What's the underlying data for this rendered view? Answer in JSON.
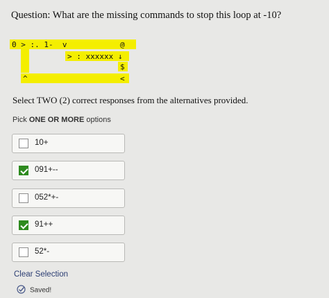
{
  "question": "Question: What are the missing commands to stop this loop at -10?",
  "code": {
    "row1_left": "0 > :. 1-  v",
    "row1_right": "@",
    "row2": "> : xxxxxx ↓",
    "row3": "$",
    "row4_left": "^",
    "row4_right": "<"
  },
  "instruction": "Select TWO (2) correct responses from the alternatives provided.",
  "pick": {
    "prefix": "Pick ",
    "emphasis": "ONE OR MORE",
    "suffix": " options"
  },
  "options": [
    {
      "label": "10+",
      "checked": false
    },
    {
      "label": "091+--",
      "checked": true
    },
    {
      "label": "052*+-",
      "checked": false
    },
    {
      "label": "91++",
      "checked": true
    },
    {
      "label": "52*-",
      "checked": false
    }
  ],
  "clear_label": "Clear Selection",
  "saved_label": "Saved!",
  "colors": {
    "highlight": "#f4ee00",
    "checked": "#2e8b1f",
    "link": "#2c3e73"
  }
}
